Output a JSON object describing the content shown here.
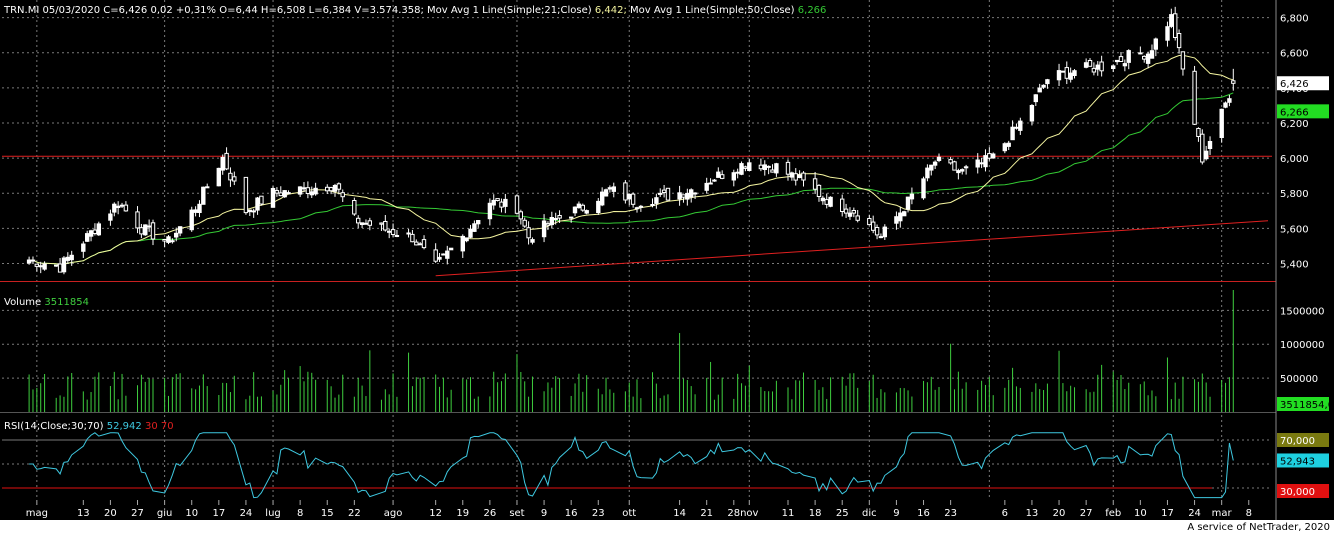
{
  "header": {
    "price_info": "TRN.MI 05/03/2020 C=6,426 0,02 +0,31% O=6,44 H=6,508 L=6,384 V=3.574.358;",
    "ma21_label": " Mov Avg 1 Line(Simple;21;Close)",
    "ma21_value": " 6,442;",
    "ma50_label": " Mov Avg 1 Line(Simple;50;Close)",
    "ma50_value": " 6,266"
  },
  "volume_header": {
    "label": "Volume",
    "value": "3511854"
  },
  "rsi_header": {
    "label": "RSI(14;Close;30;70)",
    "value": "52,942",
    "low": "30",
    "high": "70"
  },
  "price_axis_labels": [
    "6,800",
    "6,600",
    "6,400",
    "6,200",
    "6,000",
    "5,800",
    "5,600",
    "5,400"
  ],
  "volume_axis_labels": [
    "1500000",
    "1000000",
    "500000"
  ],
  "tags": {
    "last_price": "6,426",
    "ma50": "6,266",
    "volume": "3511854,0",
    "rsi_70": "70,000",
    "rsi_value": "52,943",
    "rsi_30": "30,000"
  },
  "x_axis_labels": [
    "mag",
    "13",
    "20",
    "27",
    "giu",
    "10",
    "17",
    "24",
    "lug",
    "8",
    "15",
    "22",
    "ago",
    "12",
    "19",
    "26",
    "set",
    "9",
    "16",
    "23",
    "ott",
    "14",
    "21",
    "28",
    "nov",
    "11",
    "18",
    "25",
    "dic",
    "9",
    "16",
    "23",
    "6",
    "13",
    "20",
    "27",
    "feb",
    "10",
    "17",
    "24",
    "mar",
    "8"
  ],
  "footer": "A service of NetTrader, 2020",
  "colors": {
    "background": "#000000",
    "ma21": "#f5f5a0",
    "ma50": "#34c934",
    "trendline": "#e02020",
    "support_line": "#e02020",
    "volume_bars": "#3fcf3f",
    "rsi_line": "#3ec8e0",
    "tag_last": "#ffffff",
    "tag_ma50": "#22dd22",
    "tag_rsi70": "#7a7a10",
    "tag_rsi": "#1ed0e0",
    "tag_rsi30": "#e01010"
  },
  "chart_data": {
    "type": "candlestick",
    "title": "TRN.MI",
    "price_ylim": [
      5.3,
      6.9
    ],
    "volume_ylim": [
      0,
      1800000
    ],
    "rsi_ylim": [
      20,
      80
    ],
    "rsi_levels": [
      30,
      70
    ],
    "support_level": 6.01,
    "trendline": {
      "from": {
        "date": "2019-08-12",
        "price": 5.33
      },
      "to": {
        "date": "2020-03-05",
        "price": 5.63
      }
    },
    "series": [
      {
        "name": "Mov Avg 1 Line(Simple;21;Close)",
        "last": 6.442
      },
      {
        "name": "Mov Avg 1 Line(Simple;50;Close)",
        "last": 6.266
      }
    ],
    "close_anchors": [
      [
        "2019-04-29",
        5.42
      ],
      [
        "2019-05-07",
        5.38
      ],
      [
        "2019-05-14",
        5.55
      ],
      [
        "2019-05-22",
        5.75
      ],
      [
        "2019-05-28",
        5.6
      ],
      [
        "2019-06-04",
        5.52
      ],
      [
        "2019-06-11",
        5.72
      ],
      [
        "2019-06-18",
        6.0
      ],
      [
        "2019-06-24",
        5.7
      ],
      [
        "2019-07-01",
        5.8
      ],
      [
        "2019-07-09",
        5.82
      ],
      [
        "2019-07-17",
        5.85
      ],
      [
        "2019-07-22",
        5.65
      ],
      [
        "2019-07-29",
        5.6
      ],
      [
        "2019-08-06",
        5.55
      ],
      [
        "2019-08-12",
        5.38
      ],
      [
        "2019-08-19",
        5.55
      ],
      [
        "2019-08-26",
        5.75
      ],
      [
        "2019-09-02",
        5.72
      ],
      [
        "2019-09-05",
        5.55
      ],
      [
        "2019-09-12",
        5.65
      ],
      [
        "2019-09-19",
        5.72
      ],
      [
        "2019-09-26",
        5.82
      ],
      [
        "2019-10-03",
        5.75
      ],
      [
        "2019-10-10",
        5.78
      ],
      [
        "2019-10-17",
        5.82
      ],
      [
        "2019-10-24",
        5.9
      ],
      [
        "2019-11-01",
        5.98
      ],
      [
        "2019-11-08",
        5.95
      ],
      [
        "2019-11-15",
        5.86
      ],
      [
        "2019-11-22",
        5.75
      ],
      [
        "2019-11-28",
        5.7
      ],
      [
        "2019-12-05",
        5.55
      ],
      [
        "2019-12-12",
        5.75
      ],
      [
        "2019-12-19",
        5.98
      ],
      [
        "2019-12-26",
        5.92
      ],
      [
        "2020-01-03",
        6.0
      ],
      [
        "2020-01-10",
        6.2
      ],
      [
        "2020-01-17",
        6.45
      ],
      [
        "2020-01-24",
        6.5
      ],
      [
        "2020-01-31",
        6.52
      ],
      [
        "2020-02-07",
        6.58
      ],
      [
        "2020-02-12",
        6.6
      ],
      [
        "2020-02-18",
        6.8
      ],
      [
        "2020-02-21",
        6.5
      ],
      [
        "2020-02-26",
        6.0
      ],
      [
        "2020-03-02",
        6.25
      ],
      [
        "2020-03-05",
        6.426
      ]
    ],
    "volume_last": 3511854,
    "rsi_last": 52.942
  }
}
